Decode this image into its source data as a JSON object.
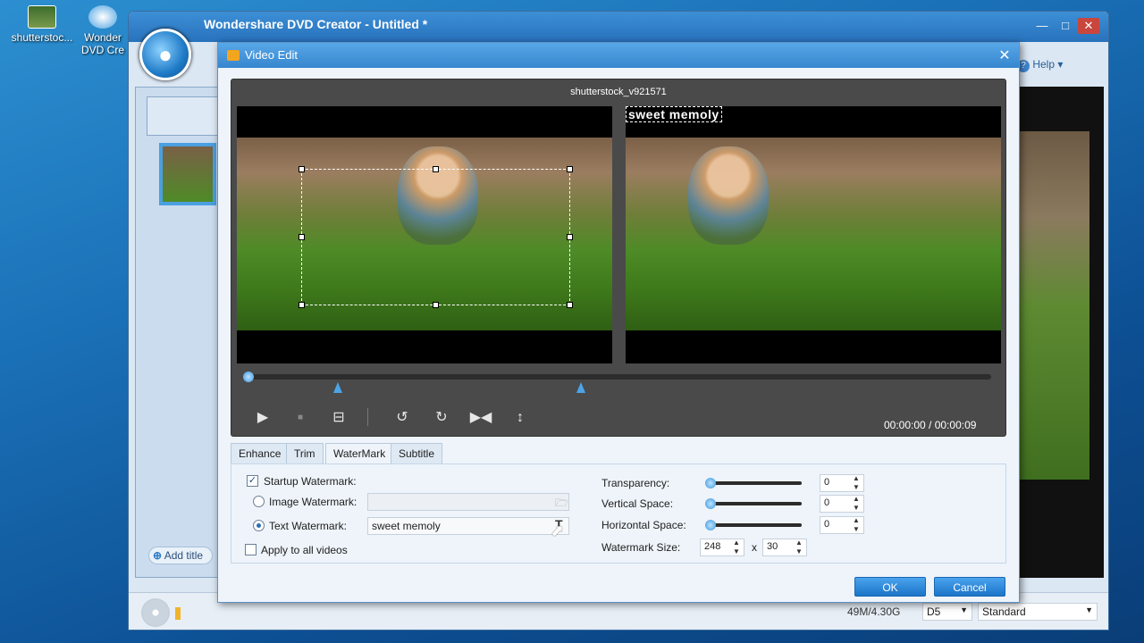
{
  "desktop": {
    "icons": [
      {
        "label": "shutterstoc...",
        "icon": "video-file-icon"
      },
      {
        "label": "Wonder DVD Cre",
        "icon": "app-shortcut-icon"
      }
    ]
  },
  "app": {
    "title": "Wondershare DVD Creator - Untitled *",
    "help_label": "Help",
    "add_title_label": "Add title",
    "disc_size": "49M/4.30G",
    "disc_type": "D5",
    "quality": "Standard",
    "window_controls": [
      "minimize-icon",
      "maximize-icon",
      "close-icon"
    ]
  },
  "dialog": {
    "title": "Video Edit",
    "file_name": "shutterstock_v921571",
    "watermark_preview_text": "sweet memoly",
    "timecode": "00:00:00 / 00:00:09",
    "progress": 0.0,
    "trim_start": 0.12,
    "trim_end": 0.47,
    "tabs": [
      "Enhance",
      "Trim",
      "WaterMark",
      "Subtitle"
    ],
    "active_tab": "WaterMark",
    "controls": {
      "play": "play-icon",
      "stop": "stop-icon",
      "snapshot": "snapshot-icon",
      "rotate_left": "rotate-left-icon",
      "rotate_right": "rotate-right-icon",
      "flip_horizontal": "flip-horizontal-icon",
      "flip_vertical": "flip-vertical-icon"
    },
    "watermark": {
      "startup_label": "Startup Watermark:",
      "startup_checked": true,
      "image_label": "Image Watermark:",
      "image_value": "",
      "text_label": "Text Watermark:",
      "text_value": "sweet memoly",
      "text_selected": true,
      "apply_all_label": "Apply to all videos",
      "apply_all_checked": false,
      "transparency_label": "Transparency:",
      "transparency_value": "0",
      "vertical_label": "Vertical Space:",
      "vertical_value": "0",
      "horizontal_label": "Horizontal Space:",
      "horizontal_value": "0",
      "size_label": "Watermark Size:",
      "size_width": "248",
      "size_x": "x",
      "size_height": "30"
    },
    "ok_label": "OK",
    "cancel_label": "Cancel"
  }
}
